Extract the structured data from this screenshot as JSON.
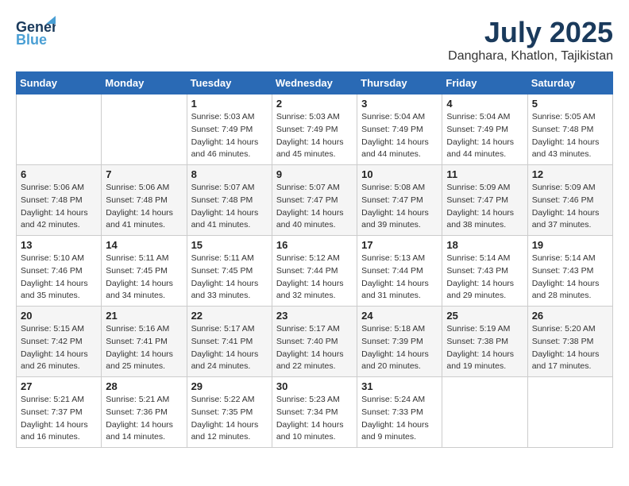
{
  "header": {
    "logo_line1": "General",
    "logo_line2": "Blue",
    "month_year": "July 2025",
    "location": "Danghara, Khatlon, Tajikistan"
  },
  "weekdays": [
    "Sunday",
    "Monday",
    "Tuesday",
    "Wednesday",
    "Thursday",
    "Friday",
    "Saturday"
  ],
  "weeks": [
    [
      {
        "day": "",
        "sunrise": "",
        "sunset": "",
        "daylight": ""
      },
      {
        "day": "",
        "sunrise": "",
        "sunset": "",
        "daylight": ""
      },
      {
        "day": "1",
        "sunrise": "Sunrise: 5:03 AM",
        "sunset": "Sunset: 7:49 PM",
        "daylight": "Daylight: 14 hours and 46 minutes."
      },
      {
        "day": "2",
        "sunrise": "Sunrise: 5:03 AM",
        "sunset": "Sunset: 7:49 PM",
        "daylight": "Daylight: 14 hours and 45 minutes."
      },
      {
        "day": "3",
        "sunrise": "Sunrise: 5:04 AM",
        "sunset": "Sunset: 7:49 PM",
        "daylight": "Daylight: 14 hours and 44 minutes."
      },
      {
        "day": "4",
        "sunrise": "Sunrise: 5:04 AM",
        "sunset": "Sunset: 7:49 PM",
        "daylight": "Daylight: 14 hours and 44 minutes."
      },
      {
        "day": "5",
        "sunrise": "Sunrise: 5:05 AM",
        "sunset": "Sunset: 7:48 PM",
        "daylight": "Daylight: 14 hours and 43 minutes."
      }
    ],
    [
      {
        "day": "6",
        "sunrise": "Sunrise: 5:06 AM",
        "sunset": "Sunset: 7:48 PM",
        "daylight": "Daylight: 14 hours and 42 minutes."
      },
      {
        "day": "7",
        "sunrise": "Sunrise: 5:06 AM",
        "sunset": "Sunset: 7:48 PM",
        "daylight": "Daylight: 14 hours and 41 minutes."
      },
      {
        "day": "8",
        "sunrise": "Sunrise: 5:07 AM",
        "sunset": "Sunset: 7:48 PM",
        "daylight": "Daylight: 14 hours and 41 minutes."
      },
      {
        "day": "9",
        "sunrise": "Sunrise: 5:07 AM",
        "sunset": "Sunset: 7:47 PM",
        "daylight": "Daylight: 14 hours and 40 minutes."
      },
      {
        "day": "10",
        "sunrise": "Sunrise: 5:08 AM",
        "sunset": "Sunset: 7:47 PM",
        "daylight": "Daylight: 14 hours and 39 minutes."
      },
      {
        "day": "11",
        "sunrise": "Sunrise: 5:09 AM",
        "sunset": "Sunset: 7:47 PM",
        "daylight": "Daylight: 14 hours and 38 minutes."
      },
      {
        "day": "12",
        "sunrise": "Sunrise: 5:09 AM",
        "sunset": "Sunset: 7:46 PM",
        "daylight": "Daylight: 14 hours and 37 minutes."
      }
    ],
    [
      {
        "day": "13",
        "sunrise": "Sunrise: 5:10 AM",
        "sunset": "Sunset: 7:46 PM",
        "daylight": "Daylight: 14 hours and 35 minutes."
      },
      {
        "day": "14",
        "sunrise": "Sunrise: 5:11 AM",
        "sunset": "Sunset: 7:45 PM",
        "daylight": "Daylight: 14 hours and 34 minutes."
      },
      {
        "day": "15",
        "sunrise": "Sunrise: 5:11 AM",
        "sunset": "Sunset: 7:45 PM",
        "daylight": "Daylight: 14 hours and 33 minutes."
      },
      {
        "day": "16",
        "sunrise": "Sunrise: 5:12 AM",
        "sunset": "Sunset: 7:44 PM",
        "daylight": "Daylight: 14 hours and 32 minutes."
      },
      {
        "day": "17",
        "sunrise": "Sunrise: 5:13 AM",
        "sunset": "Sunset: 7:44 PM",
        "daylight": "Daylight: 14 hours and 31 minutes."
      },
      {
        "day": "18",
        "sunrise": "Sunrise: 5:14 AM",
        "sunset": "Sunset: 7:43 PM",
        "daylight": "Daylight: 14 hours and 29 minutes."
      },
      {
        "day": "19",
        "sunrise": "Sunrise: 5:14 AM",
        "sunset": "Sunset: 7:43 PM",
        "daylight": "Daylight: 14 hours and 28 minutes."
      }
    ],
    [
      {
        "day": "20",
        "sunrise": "Sunrise: 5:15 AM",
        "sunset": "Sunset: 7:42 PM",
        "daylight": "Daylight: 14 hours and 26 minutes."
      },
      {
        "day": "21",
        "sunrise": "Sunrise: 5:16 AM",
        "sunset": "Sunset: 7:41 PM",
        "daylight": "Daylight: 14 hours and 25 minutes."
      },
      {
        "day": "22",
        "sunrise": "Sunrise: 5:17 AM",
        "sunset": "Sunset: 7:41 PM",
        "daylight": "Daylight: 14 hours and 24 minutes."
      },
      {
        "day": "23",
        "sunrise": "Sunrise: 5:17 AM",
        "sunset": "Sunset: 7:40 PM",
        "daylight": "Daylight: 14 hours and 22 minutes."
      },
      {
        "day": "24",
        "sunrise": "Sunrise: 5:18 AM",
        "sunset": "Sunset: 7:39 PM",
        "daylight": "Daylight: 14 hours and 20 minutes."
      },
      {
        "day": "25",
        "sunrise": "Sunrise: 5:19 AM",
        "sunset": "Sunset: 7:38 PM",
        "daylight": "Daylight: 14 hours and 19 minutes."
      },
      {
        "day": "26",
        "sunrise": "Sunrise: 5:20 AM",
        "sunset": "Sunset: 7:38 PM",
        "daylight": "Daylight: 14 hours and 17 minutes."
      }
    ],
    [
      {
        "day": "27",
        "sunrise": "Sunrise: 5:21 AM",
        "sunset": "Sunset: 7:37 PM",
        "daylight": "Daylight: 14 hours and 16 minutes."
      },
      {
        "day": "28",
        "sunrise": "Sunrise: 5:21 AM",
        "sunset": "Sunset: 7:36 PM",
        "daylight": "Daylight: 14 hours and 14 minutes."
      },
      {
        "day": "29",
        "sunrise": "Sunrise: 5:22 AM",
        "sunset": "Sunset: 7:35 PM",
        "daylight": "Daylight: 14 hours and 12 minutes."
      },
      {
        "day": "30",
        "sunrise": "Sunrise: 5:23 AM",
        "sunset": "Sunset: 7:34 PM",
        "daylight": "Daylight: 14 hours and 10 minutes."
      },
      {
        "day": "31",
        "sunrise": "Sunrise: 5:24 AM",
        "sunset": "Sunset: 7:33 PM",
        "daylight": "Daylight: 14 hours and 9 minutes."
      },
      {
        "day": "",
        "sunrise": "",
        "sunset": "",
        "daylight": ""
      },
      {
        "day": "",
        "sunrise": "",
        "sunset": "",
        "daylight": ""
      }
    ]
  ]
}
